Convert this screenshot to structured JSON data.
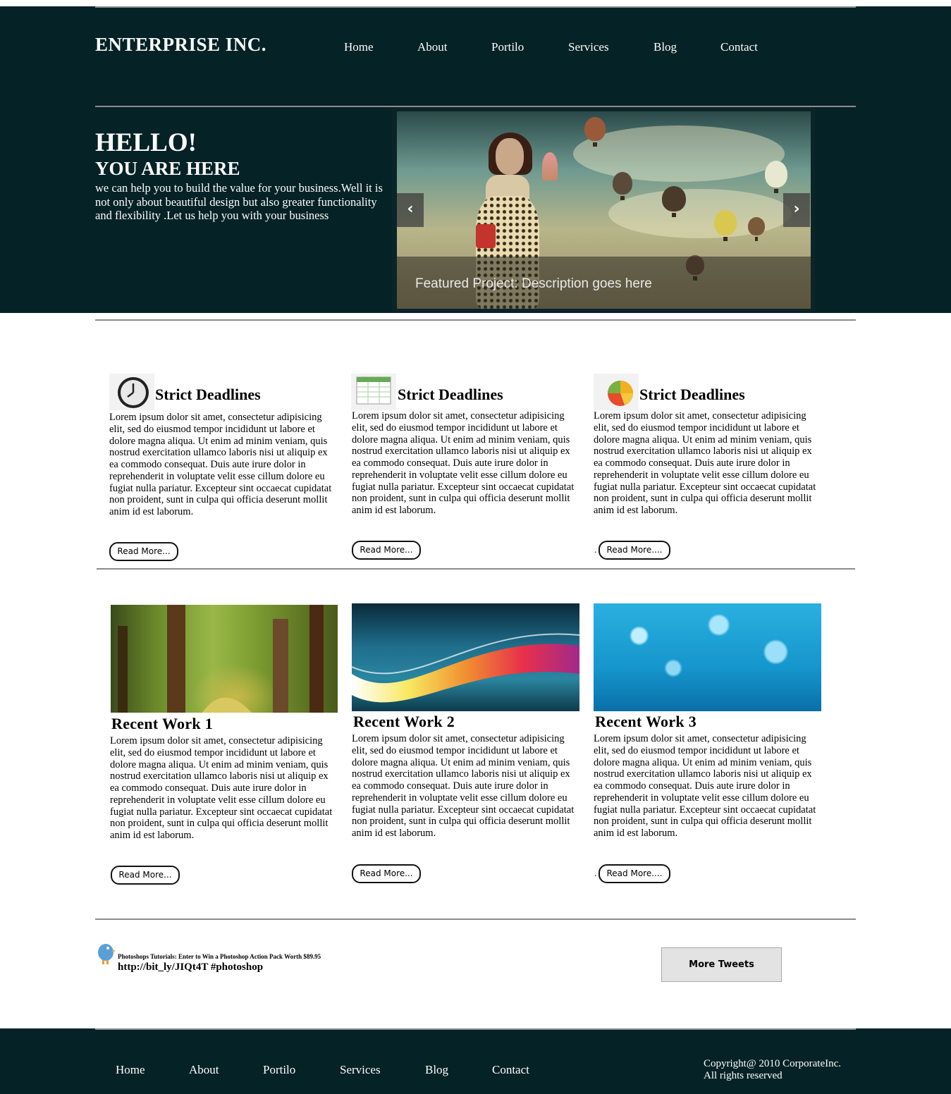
{
  "brand": "ENTERPRISE INC.",
  "nav": [
    "Home",
    "About",
    "Portilo",
    "Services",
    "Blog",
    "Contact"
  ],
  "hero": {
    "title": "HELLO!",
    "subtitle": "YOU ARE HERE",
    "text": "we can help you to build the value for your business.Well it is not only about beautiful design but also greater functionality and flexibility .Let us help you with your business",
    "slider_caption": "Featured Project: Description goes here",
    "prev_symbol": "‹",
    "next_symbol": "›"
  },
  "lorem": "Lorem ipsum dolor sit amet, consectetur adipisicing elit, sed do eiusmod tempor incididunt ut labore et dolore magna aliqua. Ut enim ad minim veniam, quis nostrud exercitation ullamco laboris nisi ut aliquip ex ea commodo consequat. Duis aute irure dolor in reprehenderit in voluptate velit esse cillum dolore eu fugiat nulla pariatur. Excepteur sint occaecat cupidatat non proident, sunt in culpa qui officia deserunt mollit anim id est laborum.",
  "features": [
    {
      "icon": "clock-icon",
      "title": "Strict Deadlines",
      "button": "Read More..."
    },
    {
      "icon": "spreadsheet-icon",
      "title": "Strict Deadlines",
      "button": "Read More..."
    },
    {
      "icon": "pie-chart-icon",
      "title": "Strict Deadlines",
      "button": "Read More...."
    }
  ],
  "works": [
    {
      "title": "Recent Work 1",
      "button": "Read More..."
    },
    {
      "title": "Recent Work 2",
      "button": "Read More..."
    },
    {
      "title": "Recent Work 3",
      "button": "Read More...."
    }
  ],
  "dot": ".",
  "tweet": {
    "headline": "Photoshops Tutorials: Enter to Win a Photoshop Action Pack Worth $89.95",
    "link": "http://bit_ly/JIQt4T #photoshop",
    "more_button": "More Tweets"
  },
  "footer": {
    "copyright_line1": "Copyright@ 2010 CorporateInc.",
    "copyright_line2": "All rights reserved"
  },
  "colors": {
    "header_bg": "#052226",
    "rule": "#8c8c8c"
  }
}
